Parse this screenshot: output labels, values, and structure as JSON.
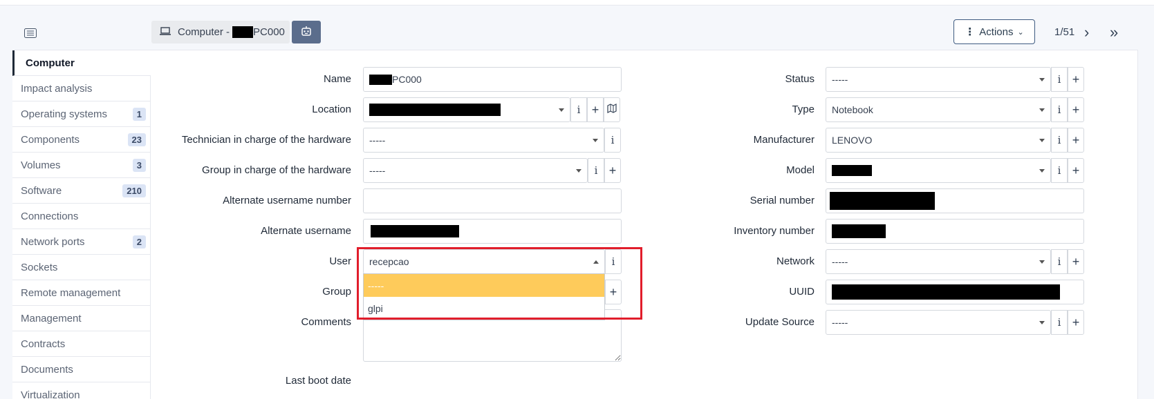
{
  "header": {
    "breadcrumb_prefix": "Computer -",
    "breadcrumb_suffix": "PC000",
    "actions_label": "Actions",
    "pager": "1/51"
  },
  "sidebar": {
    "items": [
      {
        "label": "Computer"
      },
      {
        "label": "Impact analysis"
      },
      {
        "label": "Operating systems",
        "badge": "1"
      },
      {
        "label": "Components",
        "badge": "23"
      },
      {
        "label": "Volumes",
        "badge": "3"
      },
      {
        "label": "Software",
        "badge": "210"
      },
      {
        "label": "Connections"
      },
      {
        "label": "Network ports",
        "badge": "2"
      },
      {
        "label": "Sockets"
      },
      {
        "label": "Remote management"
      },
      {
        "label": "Management"
      },
      {
        "label": "Contracts"
      },
      {
        "label": "Documents"
      },
      {
        "label": "Virtualization"
      }
    ]
  },
  "form": {
    "name_label": "Name",
    "name_suffix": "PC000",
    "location_label": "Location",
    "technician_label": "Technician in charge of the hardware",
    "technician_value": "-----",
    "group_hw_label": "Group in charge of the hardware",
    "group_hw_value": "-----",
    "alt_user_number_label": "Alternate username number",
    "alt_user_number_value": "",
    "alt_username_label": "Alternate username",
    "user_label": "User",
    "user_value": "recepcao",
    "user_options": [
      "-----",
      "glpi"
    ],
    "group_label": "Group",
    "comments_label": "Comments",
    "last_boot_label": "Last boot date",
    "status_label": "Status",
    "status_value": "-----",
    "type_label": "Type",
    "type_value": "Notebook",
    "manufacturer_label": "Manufacturer",
    "manufacturer_value": "LENOVO",
    "model_label": "Model",
    "serial_label": "Serial number",
    "inventory_label": "Inventory number",
    "network_label": "Network",
    "network_value": "-----",
    "uuid_label": "UUID",
    "update_source_label": "Update Source",
    "update_source_value": "-----",
    "info_glyph": "i",
    "plus_glyph": "+"
  },
  "colors": {
    "highlight": "#fecb5b",
    "annotation": "#e11d2b",
    "accent": "#3d5a80"
  }
}
